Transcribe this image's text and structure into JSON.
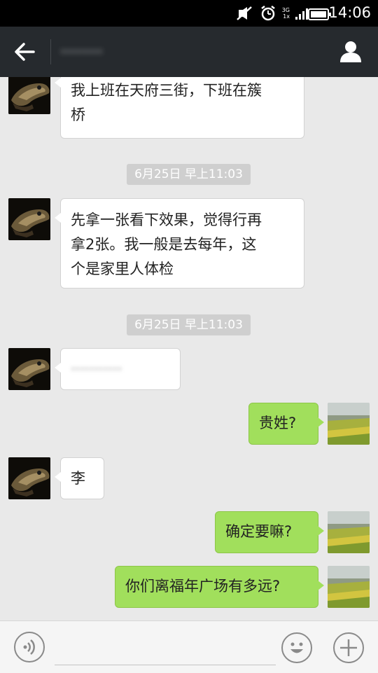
{
  "status_bar": {
    "time": "14:06",
    "network_top": "3G",
    "network_bottom": "1x"
  },
  "header": {
    "title": "········"
  },
  "messages": [
    {
      "from": "contact",
      "text_line1": "我上班在天府三街，下班在簇",
      "text_line2": "桥"
    },
    {
      "type": "timestamp",
      "text": "6月25日 早上11:03"
    },
    {
      "from": "contact",
      "text_line1": "先拿一张看下效果，觉得行再",
      "text_line2": "拿2张。我一般是去每年，这",
      "text_line3": "个是家里人体检"
    },
    {
      "type": "timestamp",
      "text": "6月25日 早上11:03"
    },
    {
      "from": "contact",
      "text": "···········"
    },
    {
      "from": "me",
      "text": "贵姓?"
    },
    {
      "from": "contact",
      "text": "李"
    },
    {
      "from": "me",
      "text": "确定要嘛?"
    },
    {
      "from": "me",
      "text": "你们离福年广场有多远?"
    }
  ],
  "input": {
    "value": "",
    "placeholder": ""
  },
  "icons": {
    "back": "arrow-left-icon",
    "profile": "person-icon",
    "voice": "voice-icon",
    "emoji": "smiley-icon",
    "plus": "plus-icon"
  },
  "colors": {
    "header_bg": "#262a2e",
    "outgoing_bubble": "#a1df5c",
    "incoming_bubble": "#ffffff",
    "chat_bg": "#e9e9e9",
    "timestamp_bg": "#cfcfcf"
  }
}
